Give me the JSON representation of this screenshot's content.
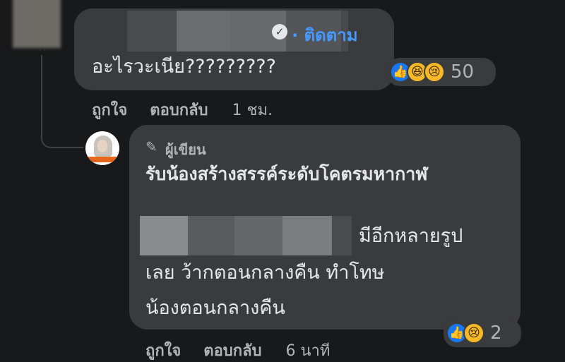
{
  "comment": {
    "follow_label": "ติดตาม",
    "text": "อะไรวะเนีย?????????",
    "reactions": [
      "like",
      "haha",
      "sad"
    ],
    "reaction_count": "50",
    "actions": {
      "like": "ถูกใจ",
      "reply": "ตอบกลับ",
      "time": "1 ชม."
    }
  },
  "reply": {
    "badge": "ผู้เขียน",
    "page_name": "รับน้องสร้างสรรค์ระดับโคตรมหากาฬ",
    "line1": "มีอีกหลายรูป",
    "line2": "เลย ว้ากตอนกลางคืน ทำโทษ",
    "line3": "น้องตอนกลางคืน",
    "reactions": [
      "like",
      "sad"
    ],
    "reaction_count": "2",
    "actions": {
      "like": "ถูกใจ",
      "reply": "ตอบกลับ",
      "time": "6 นาที"
    }
  },
  "colors": {
    "background": "#18191a",
    "bubble": "#3a3b3c",
    "link": "#4599ff",
    "secondary_text": "#b0b3b8",
    "like": "#1877f2"
  }
}
